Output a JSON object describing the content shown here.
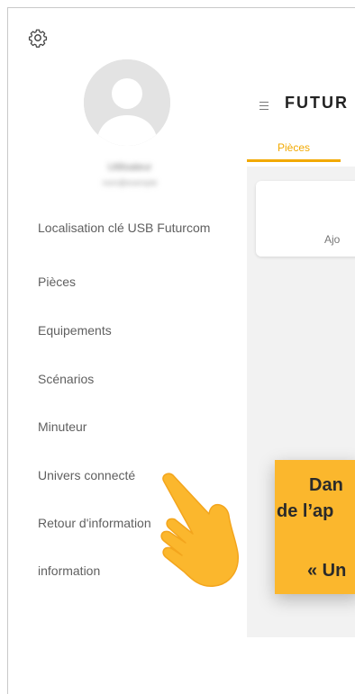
{
  "drawer": {
    "user": {
      "name": "Utilisateur",
      "email": "nom@exemple"
    },
    "items": [
      {
        "label": "Localisation clé USB Futurcom"
      },
      {
        "label": "Pièces"
      },
      {
        "label": "Equipements"
      },
      {
        "label": "Scénarios"
      },
      {
        "label": "Minuteur"
      },
      {
        "label": "Univers connecté"
      },
      {
        "label": "Retour d'information"
      },
      {
        "label": "information"
      }
    ]
  },
  "header": {
    "logo_text": "FUTUR"
  },
  "tabs": [
    {
      "label": "Pièces",
      "active": true
    }
  ],
  "card": {
    "text": "Ajo"
  },
  "callout": {
    "line1": "Dan",
    "line2": "de l’ap",
    "line3": "« Un"
  },
  "colors": {
    "accent": "#f2a900",
    "callout_bg": "#fbb72d"
  },
  "icons": [
    "gear-icon",
    "avatar-icon",
    "hamburger-icon",
    "hand-pointer-icon"
  ]
}
